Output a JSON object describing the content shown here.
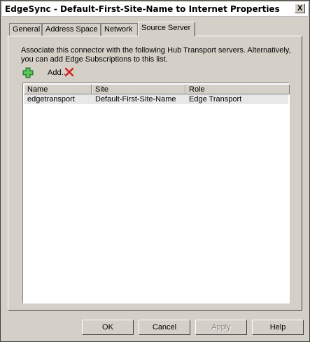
{
  "window": {
    "title": "EdgeSync - Default-First-Site-Name to Internet Properties",
    "close_glyph": "X"
  },
  "tabs": [
    {
      "label": "General"
    },
    {
      "label": "Address Space"
    },
    {
      "label": "Network"
    },
    {
      "label": "Source Server",
      "active": true
    }
  ],
  "source_server": {
    "description": "Associate this connector with the following Hub Transport servers. Alternatively, you can add Edge Subscriptions to this list.",
    "add_label": "Add...",
    "remove_icon": "red-x-icon",
    "columns": [
      "Name",
      "Site",
      "Role"
    ],
    "rows": [
      {
        "name": "edgetransport",
        "site": "Default-First-Site-Name",
        "role": "Edge Transport"
      }
    ]
  },
  "buttons": {
    "ok": "OK",
    "cancel": "Cancel",
    "apply": "Apply",
    "help": "Help"
  },
  "colors": {
    "add_icon": "#3aa33a",
    "remove_icon": "#d42020"
  }
}
